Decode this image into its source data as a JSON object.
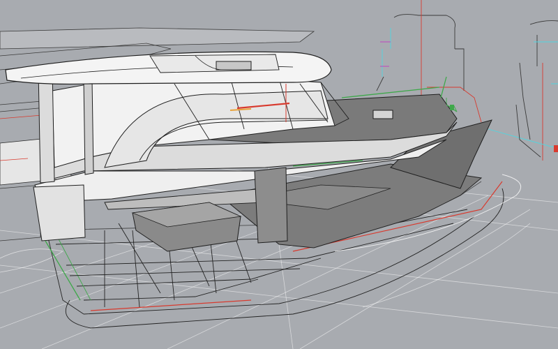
{
  "viewport": {
    "background_color": "#a8abb0",
    "grid_color": "#ffffff",
    "wire_color": "#2a2a2a",
    "surface_light": "#e9e9e9",
    "surface_mid": "#cfcfcf",
    "surface_dark": "#7c7c7c",
    "accent_red": "#d83a2e",
    "accent_green": "#3ea84a",
    "accent_cyan": "#4fd6e0",
    "accent_magenta": "#c044c0"
  }
}
